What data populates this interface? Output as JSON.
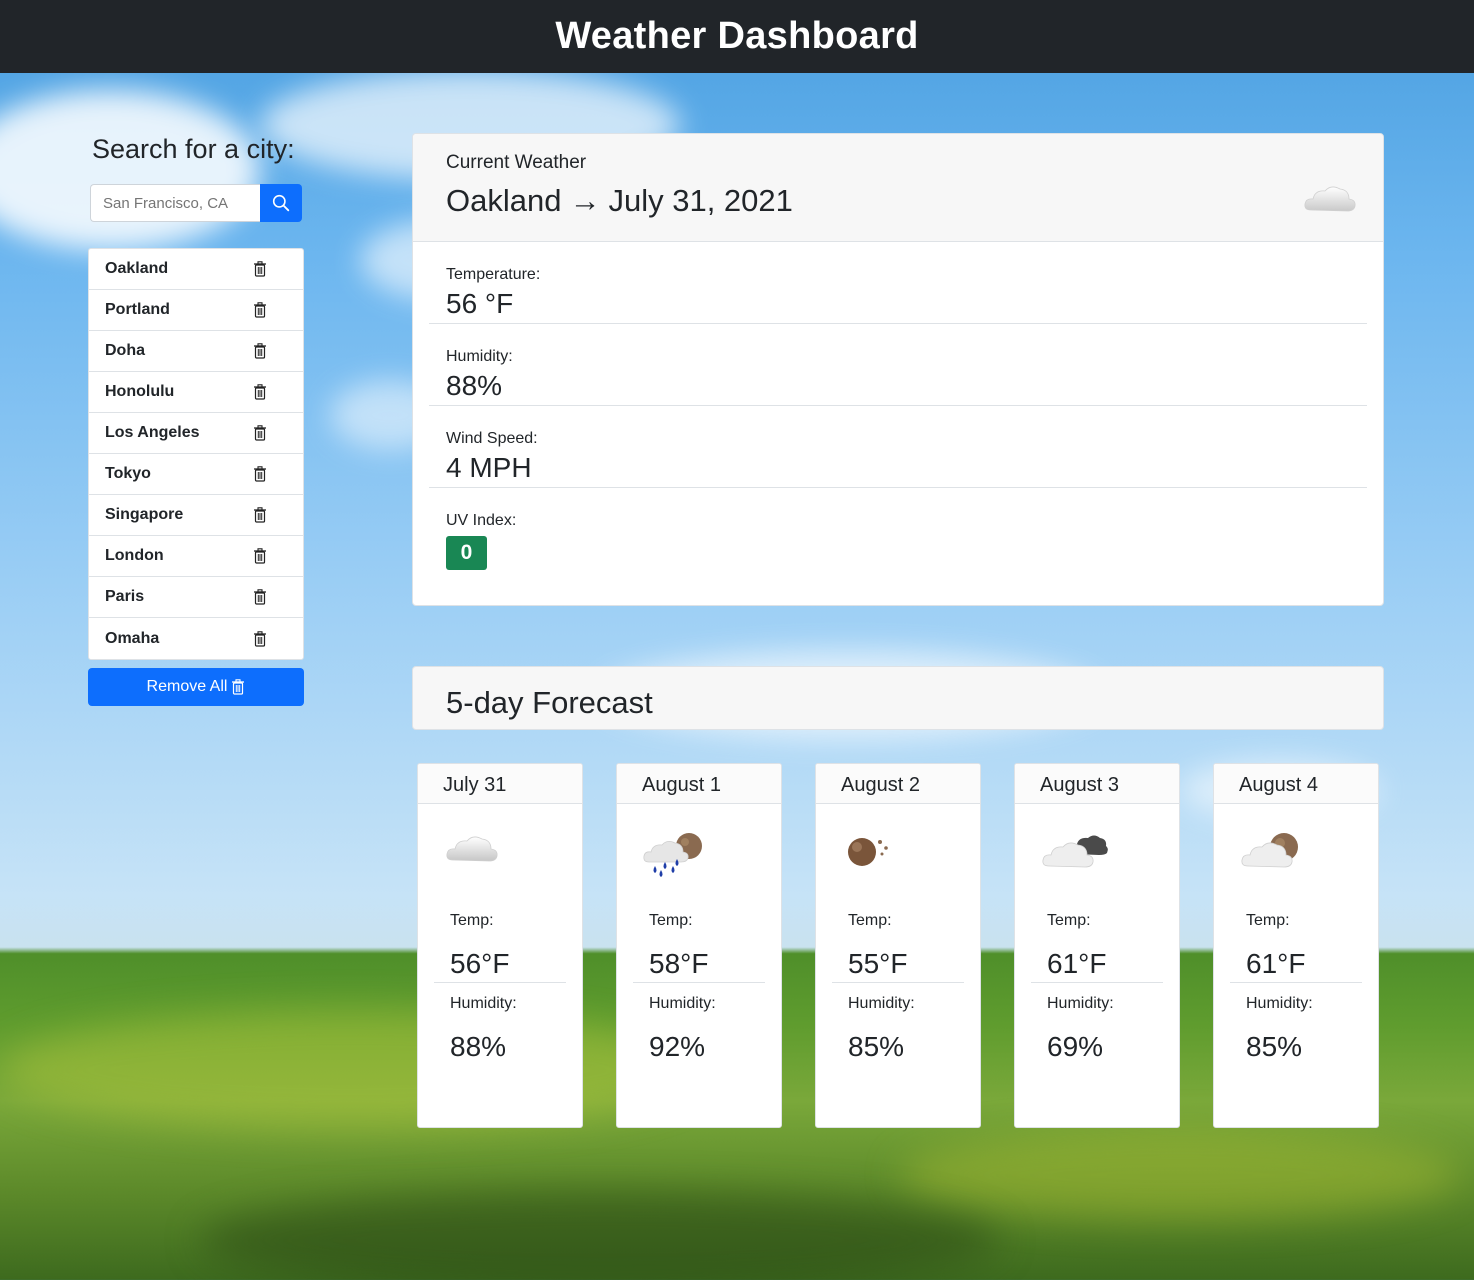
{
  "header": {
    "title": "Weather Dashboard"
  },
  "search": {
    "heading": "Search for a city:",
    "placeholder": "San Francisco, CA",
    "button_icon": "search-icon"
  },
  "cities": [
    {
      "name": "Oakland"
    },
    {
      "name": "Portland"
    },
    {
      "name": "Doha"
    },
    {
      "name": "Honolulu"
    },
    {
      "name": "Los Angeles"
    },
    {
      "name": "Tokyo"
    },
    {
      "name": "Singapore"
    },
    {
      "name": "London"
    },
    {
      "name": "Paris"
    },
    {
      "name": "Omaha"
    }
  ],
  "remove_all": {
    "label": "Remove All"
  },
  "current": {
    "label": "Current Weather",
    "city": "Oakland",
    "arrow": "→",
    "date": "July 31, 2021",
    "icon": "cloud-icon",
    "temperature_label": "Temperature:",
    "temperature": "56 °F",
    "humidity_label": "Humidity:",
    "humidity": "88%",
    "wind_label": "Wind Speed:",
    "wind": "4 MPH",
    "uv_label": "UV Index:",
    "uv": "0",
    "uv_color": "#198754"
  },
  "forecast": {
    "heading": "5-day Forecast",
    "days": [
      {
        "date": "July 31",
        "icon": "cloud-icon",
        "temp_label": "Temp:",
        "temp": "56°F",
        "humidity_label": "Humidity:",
        "humidity": "88%"
      },
      {
        "date": "August 1",
        "icon": "rain-moon-icon",
        "temp_label": "Temp:",
        "temp": "58°F",
        "humidity_label": "Humidity:",
        "humidity": "92%"
      },
      {
        "date": "August 2",
        "icon": "moon-icon",
        "temp_label": "Temp:",
        "temp": "55°F",
        "humidity_label": "Humidity:",
        "humidity": "85%"
      },
      {
        "date": "August 3",
        "icon": "dark-clouds-icon",
        "temp_label": "Temp:",
        "temp": "61°F",
        "humidity_label": "Humidity:",
        "humidity": "69%"
      },
      {
        "date": "August 4",
        "icon": "cloud-moon-icon",
        "temp_label": "Temp:",
        "temp": "61°F",
        "humidity_label": "Humidity:",
        "humidity": "85%"
      }
    ]
  },
  "colors": {
    "header_bg": "#212529",
    "primary": "#0d6efd",
    "success": "#198754"
  }
}
